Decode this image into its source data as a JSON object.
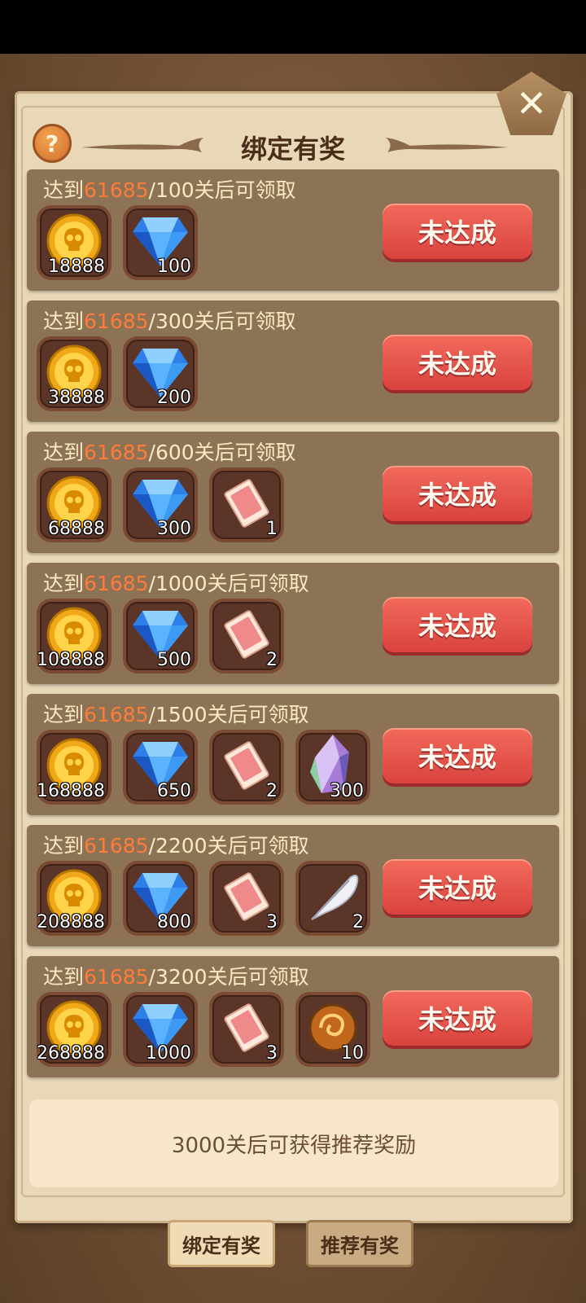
{
  "header": {
    "title": "绑定有奖",
    "help_symbol": "?",
    "close_symbol": "✕"
  },
  "colors": {
    "accent": "#ff7b3a",
    "button": "#e24f47"
  },
  "rows": [
    {
      "prefix": "达到",
      "progress": "61685",
      "target": "/100关后可领取",
      "button": "未达成",
      "items": [
        {
          "icon": "skull-coin-icon",
          "count": "18888"
        },
        {
          "icon": "diamond-icon",
          "count": "100"
        }
      ]
    },
    {
      "prefix": "达到",
      "progress": "61685",
      "target": "/300关后可领取",
      "button": "未达成",
      "items": [
        {
          "icon": "skull-coin-icon",
          "count": "38888"
        },
        {
          "icon": "diamond-icon",
          "count": "200"
        }
      ]
    },
    {
      "prefix": "达到",
      "progress": "61685",
      "target": "/600关后可领取",
      "button": "未达成",
      "items": [
        {
          "icon": "skull-coin-icon",
          "count": "68888"
        },
        {
          "icon": "diamond-icon",
          "count": "300"
        },
        {
          "icon": "ticket-icon",
          "count": "1"
        }
      ]
    },
    {
      "prefix": "达到",
      "progress": "61685",
      "target": "/1000关后可领取",
      "button": "未达成",
      "items": [
        {
          "icon": "skull-coin-icon",
          "count": "108888"
        },
        {
          "icon": "diamond-icon",
          "count": "500"
        },
        {
          "icon": "ticket-icon",
          "count": "2"
        }
      ]
    },
    {
      "prefix": "达到",
      "progress": "61685",
      "target": "/1500关后可领取",
      "button": "未达成",
      "items": [
        {
          "icon": "skull-coin-icon",
          "count": "168888"
        },
        {
          "icon": "diamond-icon",
          "count": "650"
        },
        {
          "icon": "ticket-icon",
          "count": "2"
        },
        {
          "icon": "crystal-icon",
          "count": "300"
        }
      ]
    },
    {
      "prefix": "达到",
      "progress": "61685",
      "target": "/2200关后可领取",
      "button": "未达成",
      "items": [
        {
          "icon": "skull-coin-icon",
          "count": "208888"
        },
        {
          "icon": "diamond-icon",
          "count": "800"
        },
        {
          "icon": "ticket-icon",
          "count": "3"
        },
        {
          "icon": "feather-icon",
          "count": "2"
        }
      ]
    },
    {
      "prefix": "达到",
      "progress": "61685",
      "target": "/3200关后可领取",
      "button": "未达成",
      "items": [
        {
          "icon": "skull-coin-icon",
          "count": "268888"
        },
        {
          "icon": "diamond-icon",
          "count": "1000"
        },
        {
          "icon": "ticket-icon",
          "count": "3"
        },
        {
          "icon": "orb-icon",
          "count": "10"
        }
      ]
    }
  ],
  "bottom_note": "3000关后可获得推荐奖励",
  "tabs": [
    {
      "label": "绑定有奖"
    },
    {
      "label": "推荐有奖"
    }
  ]
}
